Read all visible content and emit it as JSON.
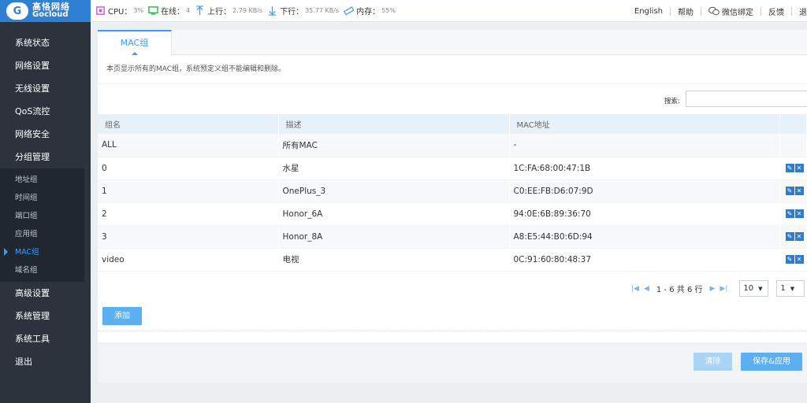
{
  "logo": {
    "cn": "高恪网络",
    "en": "Gocloud"
  },
  "status": {
    "cpu_label": "CPU：",
    "cpu_value": "3%",
    "online_label": "在线：",
    "online_value": "4",
    "up_label": "上行：",
    "up_value": "2.79 KB/s",
    "down_label": "下行：",
    "down_value": "35.77 KB/s",
    "mem_label": "内存：",
    "mem_value": "55%"
  },
  "top_links": {
    "english": "English",
    "help": "帮助",
    "wechat": "微信绑定",
    "feedback": "反馈",
    "exit": "退"
  },
  "sidebar": {
    "items": [
      "系统状态",
      "网络设置",
      "无线设置",
      "QoS流控",
      "网络安全",
      "分组管理"
    ],
    "sub_items": [
      "地址组",
      "时间组",
      "端口组",
      "应用组",
      "MAC组",
      "域名组"
    ],
    "items_after": [
      "高级设置",
      "系统管理",
      "系统工具",
      "退出"
    ]
  },
  "tab": {
    "label": "MAC组"
  },
  "description": "本页显示所有的MAC组，系统预定义组不能编辑和删除。",
  "search": {
    "label": "搜索:",
    "value": ""
  },
  "table": {
    "headers": [
      "组名",
      "描述",
      "MAC地址",
      ""
    ],
    "rows": [
      {
        "name": "ALL",
        "desc": "所有MAC",
        "mac": "-",
        "editable": false
      },
      {
        "name": "0",
        "desc": "水星",
        "mac": "1C:FA:68:00:47:1B",
        "editable": true
      },
      {
        "name": "1",
        "desc": "OnePlus_3",
        "mac": "C0:EE:FB:D6:07:9D",
        "editable": true
      },
      {
        "name": "2",
        "desc": "Honor_6A",
        "mac": "94:0E:6B:89:36:70",
        "editable": true
      },
      {
        "name": "3",
        "desc": "Honor_8A",
        "mac": "A8:E5:44:B0:6D:94",
        "editable": true
      },
      {
        "name": "video",
        "desc": "电视",
        "mac": "0C:91:60:80:48:37",
        "editable": true
      }
    ]
  },
  "pager": {
    "summary": "1 - 6 共 6 行",
    "page_size": "10",
    "page": "1"
  },
  "buttons": {
    "add": "添加",
    "clear": "清除",
    "save": "保存&应用"
  },
  "colors": {
    "accent": "#3a9bff",
    "sidebar_bg": "#2c333d"
  }
}
